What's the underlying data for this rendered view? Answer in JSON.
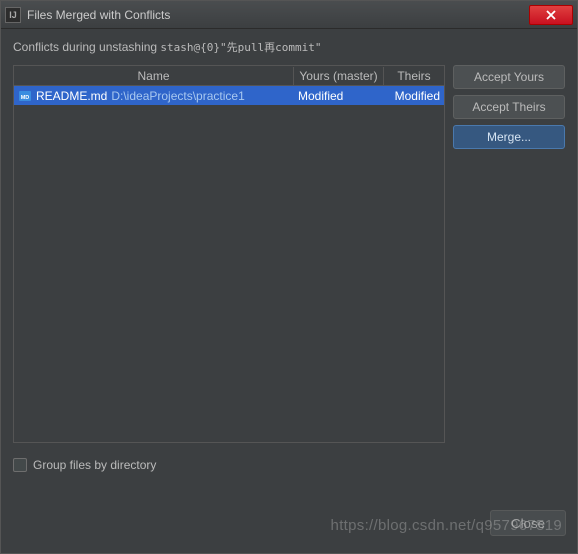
{
  "window": {
    "title": "Files Merged with Conflicts",
    "icon_label": "IJ"
  },
  "subtitle": {
    "prefix": "Conflicts during unstashing ",
    "stash_ref": "stash@{0}\"先pull再commit\""
  },
  "table": {
    "columns": {
      "name": "Name",
      "yours": "Yours (master)",
      "theirs": "Theirs"
    },
    "rows": [
      {
        "filename": "README.md",
        "filepath": "D:\\ideaProjects\\practice1",
        "yours": "Modified",
        "theirs": "Modified",
        "icon": "markdown-file-icon"
      }
    ]
  },
  "buttons": {
    "accept_yours": "Accept Yours",
    "accept_theirs": "Accept Theirs",
    "merge": "Merge...",
    "close": "Close"
  },
  "checkbox": {
    "group_by_dir": "Group files by directory",
    "checked": false
  },
  "watermark": "https://blog.csdn.net/q957967519"
}
